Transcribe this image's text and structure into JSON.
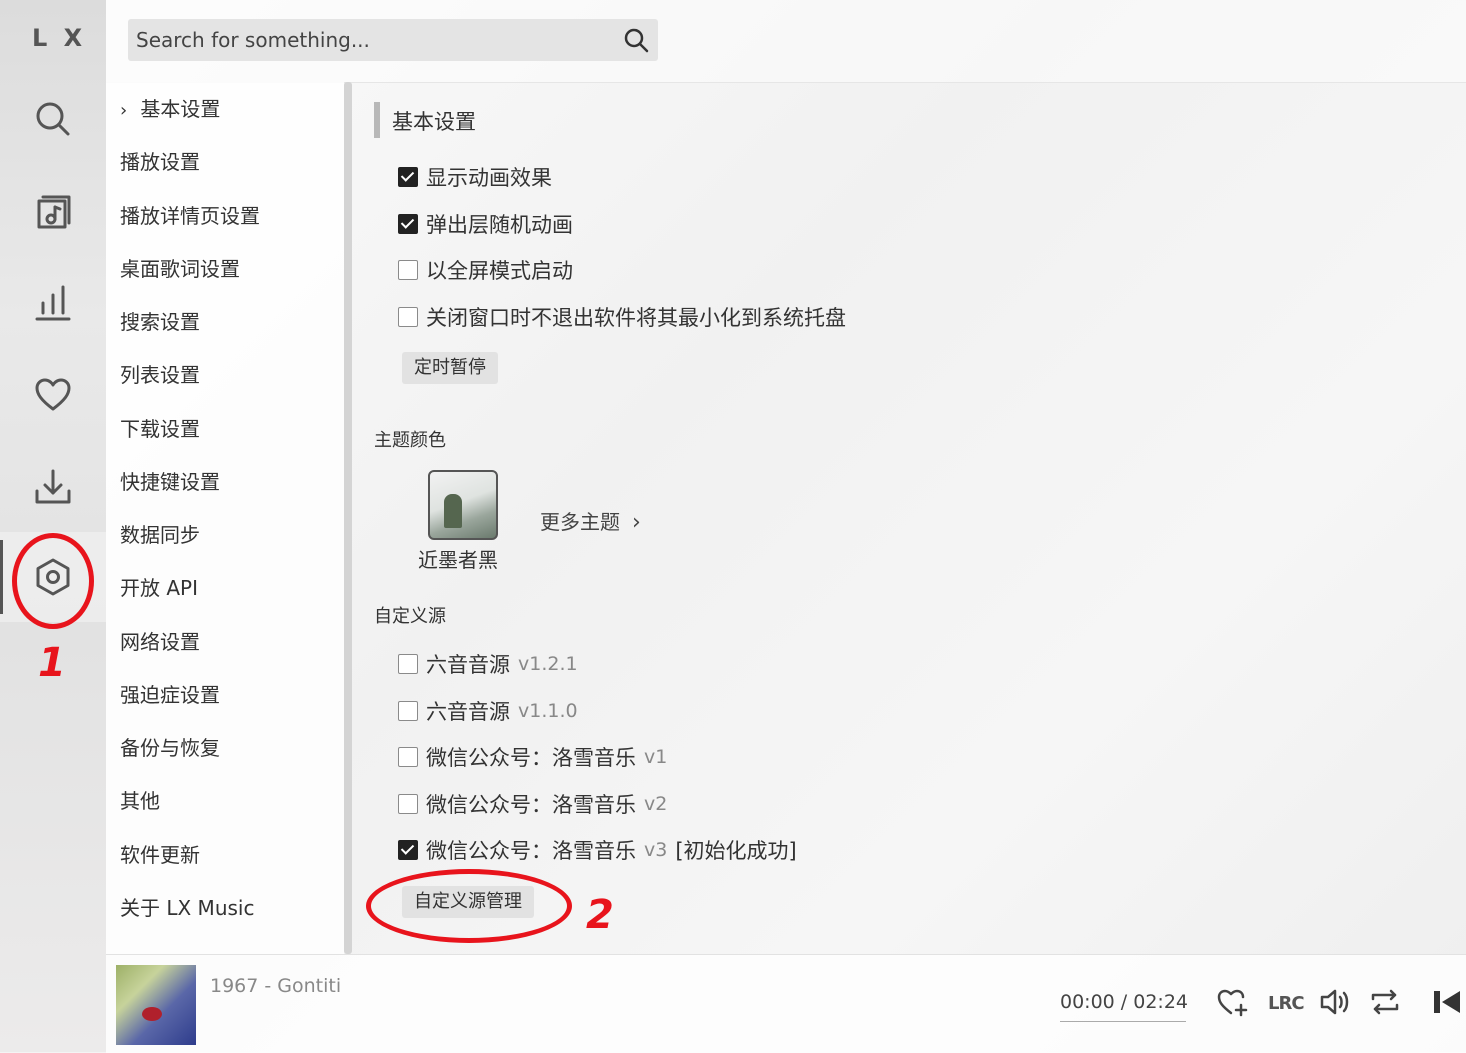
{
  "app": {
    "logo": "L X"
  },
  "search": {
    "placeholder": "Search for something..."
  },
  "settings_nav": [
    "基本设置",
    "播放设置",
    "播放详情页设置",
    "桌面歌词设置",
    "搜索设置",
    "列表设置",
    "下载设置",
    "快捷键设置",
    "数据同步",
    "开放 API",
    "网络设置",
    "强迫症设置",
    "备份与恢复",
    "其他",
    "软件更新",
    "关于 LX Music"
  ],
  "basic": {
    "title": "基本设置",
    "options": [
      {
        "label": "显示动画效果",
        "checked": true
      },
      {
        "label": "弹出层随机动画",
        "checked": true
      },
      {
        "label": "以全屏模式启动",
        "checked": false
      },
      {
        "label": "关闭窗口时不退出软件将其最小化到系统托盘",
        "checked": false
      }
    ],
    "timer_button": "定时暂停"
  },
  "theme": {
    "label": "主题颜色",
    "current": "近墨者黑",
    "more": "更多主题"
  },
  "custom_source": {
    "label": "自定义源",
    "sources": [
      {
        "name": "六音音源",
        "version": "v1.2.1",
        "checked": false,
        "status": ""
      },
      {
        "name": "六音音源",
        "version": "v1.1.0",
        "checked": false,
        "status": ""
      },
      {
        "name": "微信公众号：洛雪音乐",
        "version": "v1",
        "checked": false,
        "status": ""
      },
      {
        "name": "微信公众号：洛雪音乐",
        "version": "v2",
        "checked": false,
        "status": ""
      },
      {
        "name": "微信公众号：洛雪音乐",
        "version": "v3",
        "checked": true,
        "status": "[初始化成功]"
      }
    ],
    "manage_button": "自定义源管理"
  },
  "annotations": {
    "one": "1",
    "two": "2",
    "color": "#e8141c"
  },
  "player": {
    "song": "1967 - Gontiti",
    "time": "00:00 / 02:24",
    "lrc": "LRC"
  }
}
